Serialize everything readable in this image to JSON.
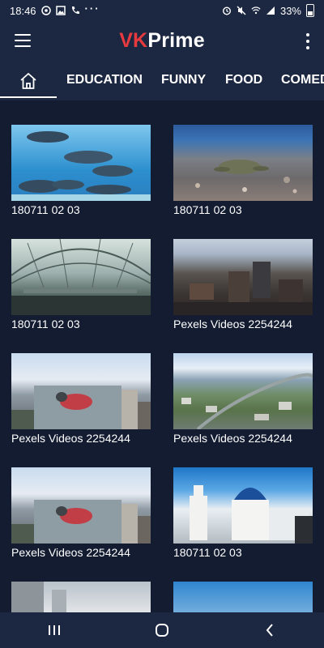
{
  "status_bar": {
    "time": "18:46",
    "battery": "33%",
    "icons": [
      "circle-icon",
      "image-icon",
      "phone-icon",
      "more-dots-icon",
      "alarm-icon",
      "mute-icon",
      "wifi-icon",
      "signal-icon",
      "battery-icon"
    ]
  },
  "app_bar": {
    "logo_vk": "VK",
    "logo_prime": "Prime",
    "menu_icon": "hamburger-icon",
    "overflow_icon": "kebab-icon"
  },
  "tabs": [
    {
      "id": "home",
      "label": "",
      "icon": "home-icon",
      "selected": true
    },
    {
      "id": "education",
      "label": "EDUCATION"
    },
    {
      "id": "funny",
      "label": "FUNNY"
    },
    {
      "id": "food",
      "label": "FOOD"
    },
    {
      "id": "comedy",
      "label": "COMED"
    }
  ],
  "videos": [
    {
      "title": "180711 02 03"
    },
    {
      "title": "180711 02 03"
    },
    {
      "title": "180711 02 03"
    },
    {
      "title": "Pexels Videos 2254244"
    },
    {
      "title": "Pexels Videos 2254244"
    },
    {
      "title": "Pexels Videos 2254244"
    },
    {
      "title": "Pexels Videos 2254244"
    },
    {
      "title": "180711 02 03"
    },
    {
      "title": ""
    },
    {
      "title": ""
    }
  ],
  "nav_bar": {
    "buttons": [
      "recents-icon",
      "home-circle-icon",
      "back-icon"
    ]
  },
  "colors": {
    "background": "#1c2841",
    "content_bg": "#141c32",
    "accent_red": "#e63a3f",
    "text": "#ffffff"
  }
}
